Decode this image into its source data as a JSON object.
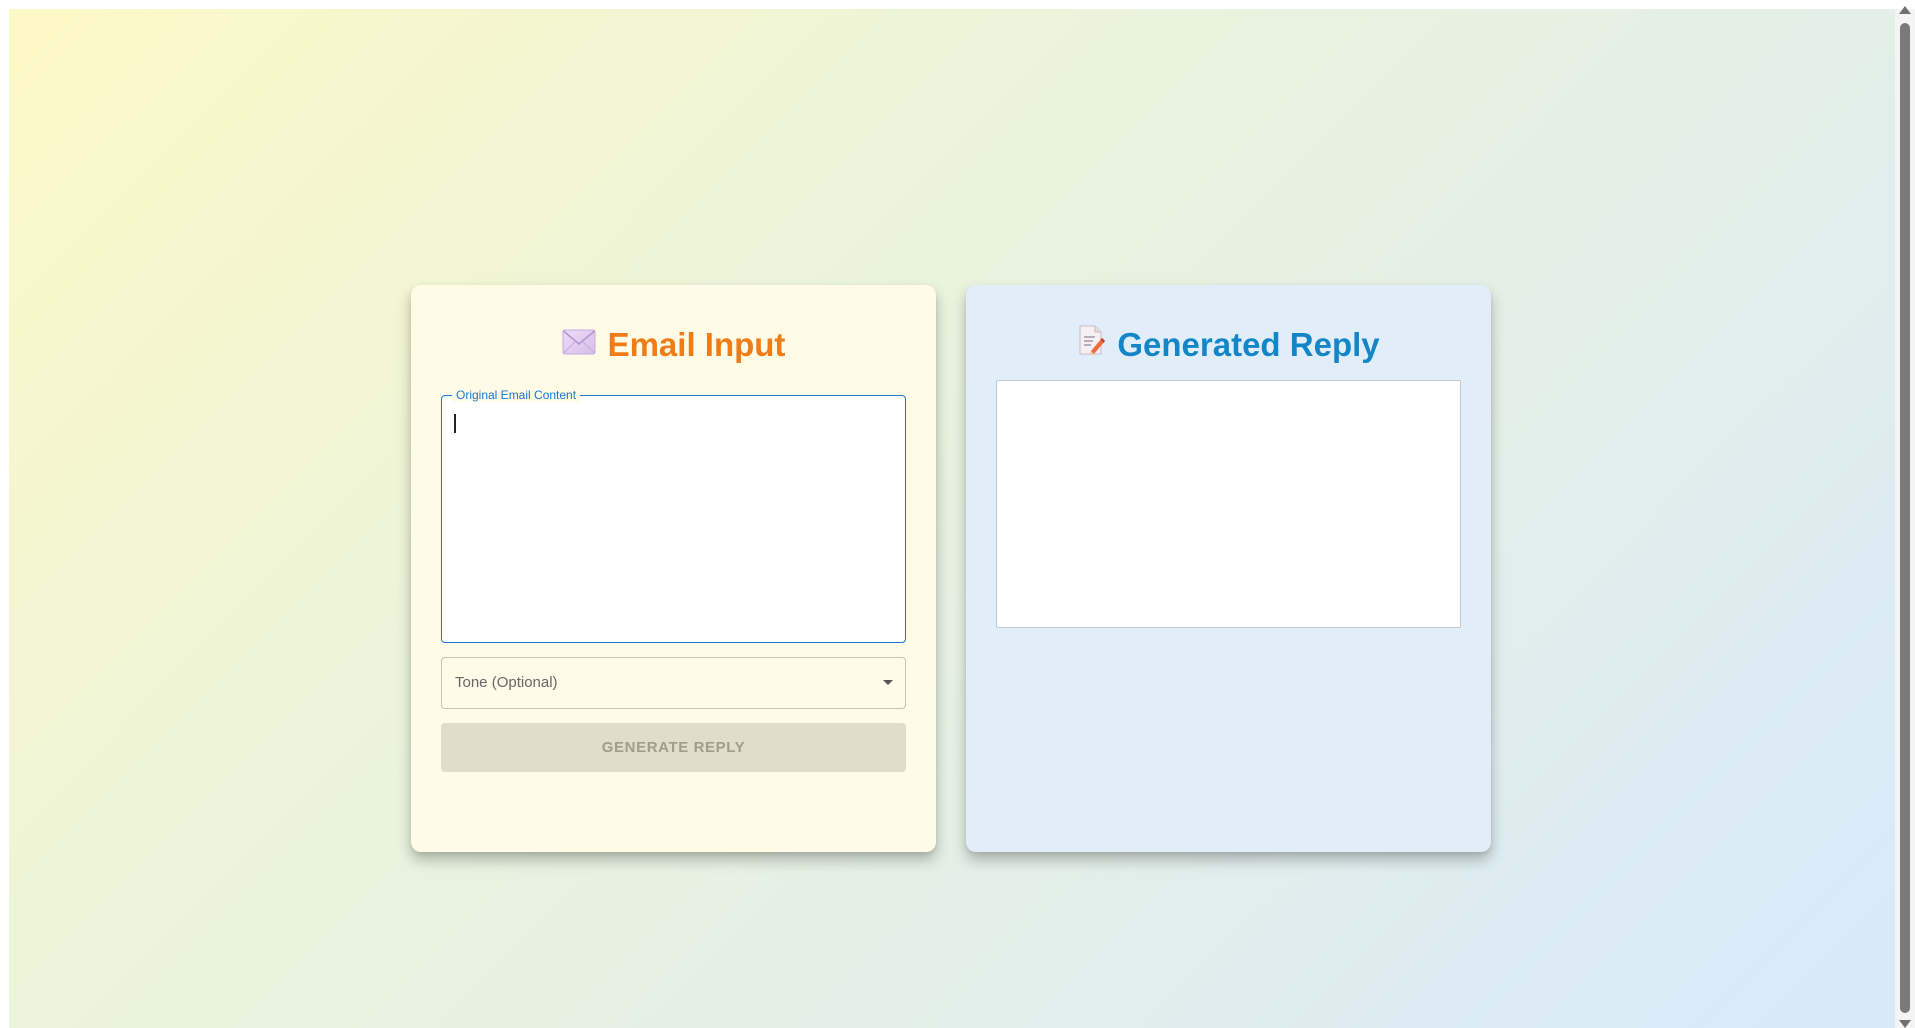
{
  "email_card": {
    "title": "Email Input",
    "icon": "envelope-icon",
    "title_color": "#ef7c17",
    "field_label": "Original Email Content",
    "field_value": "",
    "tone_select": {
      "label": "Tone (Optional)",
      "selected": ""
    },
    "generate_button": "GENERATE REPLY"
  },
  "reply_card": {
    "title": "Generated Reply",
    "icon": "memo-pencil-icon",
    "title_color": "#1386c8",
    "reply_text": ""
  },
  "colors": {
    "accent_blue": "#1976d2",
    "input_card_bg": "#fffbe6",
    "reply_card_bg": "#e1eefa",
    "disabled_button_bg": "#e1ddcb"
  }
}
